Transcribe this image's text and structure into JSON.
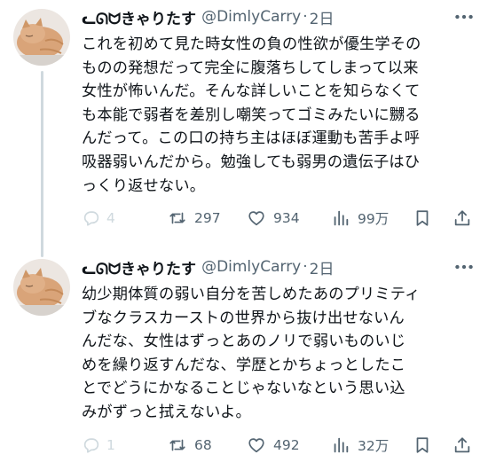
{
  "tweets": [
    {
      "display_name": "ᓚᘏᗢきゃりたす",
      "handle": "@DimlyCarry",
      "separator": "·",
      "time": "2日",
      "text_lines": [
        "これを初めて見た時女性の負の性欲が優生学その",
        "ものの発想だって完全に腹落ちしてしまって以来",
        "女性が怖いんだ。そんな詳しいことを知らなくて",
        "も本能で弱者を差別し嘲笑ってゴミみたいに嬲る",
        "んだって。この口の持ち主はほぼ運動も苦手よ呼",
        "吸器弱いんだから。勉強しても弱男の遺伝子はひ",
        "っくり返せない。"
      ],
      "metrics": {
        "replies": "4",
        "reposts": "297",
        "likes": "934",
        "views": "99万"
      }
    },
    {
      "display_name": "ᓚᘏᗢきゃりたす",
      "handle": "@DimlyCarry",
      "separator": "·",
      "time": "2日",
      "text_lines": [
        "幼少期体質の弱い自分を苦しめたあのプリミティ",
        "ブなクラスカーストの世界から抜け出せないん",
        "んだな、女性はずっとあのノリで弱いものいじ",
        "めを繰り返すんだな、学歴とかちょっとしたこ",
        "とでどうにかなることじゃないなという思い込",
        "みがずっと拭えないよ。"
      ],
      "metrics": {
        "replies": "1",
        "reposts": "68",
        "likes": "492",
        "views": "32万"
      }
    }
  ],
  "icons": {
    "reply": "speech-bubble-icon",
    "repost": "repost-arrows-icon",
    "like": "heart-icon",
    "views": "bar-chart-icon",
    "bookmark": "bookmark-icon",
    "share": "share-upload-icon",
    "more": "more-dots-icon"
  },
  "colors": {
    "text": "#0f1419",
    "secondary": "#536471",
    "thread_line": "#cfd9de",
    "background": "#ffffff"
  }
}
